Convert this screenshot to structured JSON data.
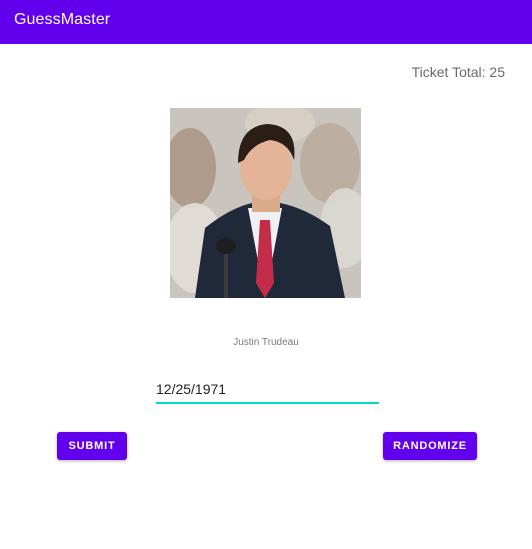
{
  "app_bar": {
    "title": "GuessMaster"
  },
  "ticket": {
    "label": "Ticket Total: 25"
  },
  "entity": {
    "name": "Justin Trudeau"
  },
  "date_input": {
    "value": "12/25/1971"
  },
  "buttons": {
    "submit_label": "SUBMIT",
    "randomize_label": "RANDOMIZE"
  },
  "colors": {
    "primary": "#6200ee",
    "accent": "#03dac5"
  }
}
